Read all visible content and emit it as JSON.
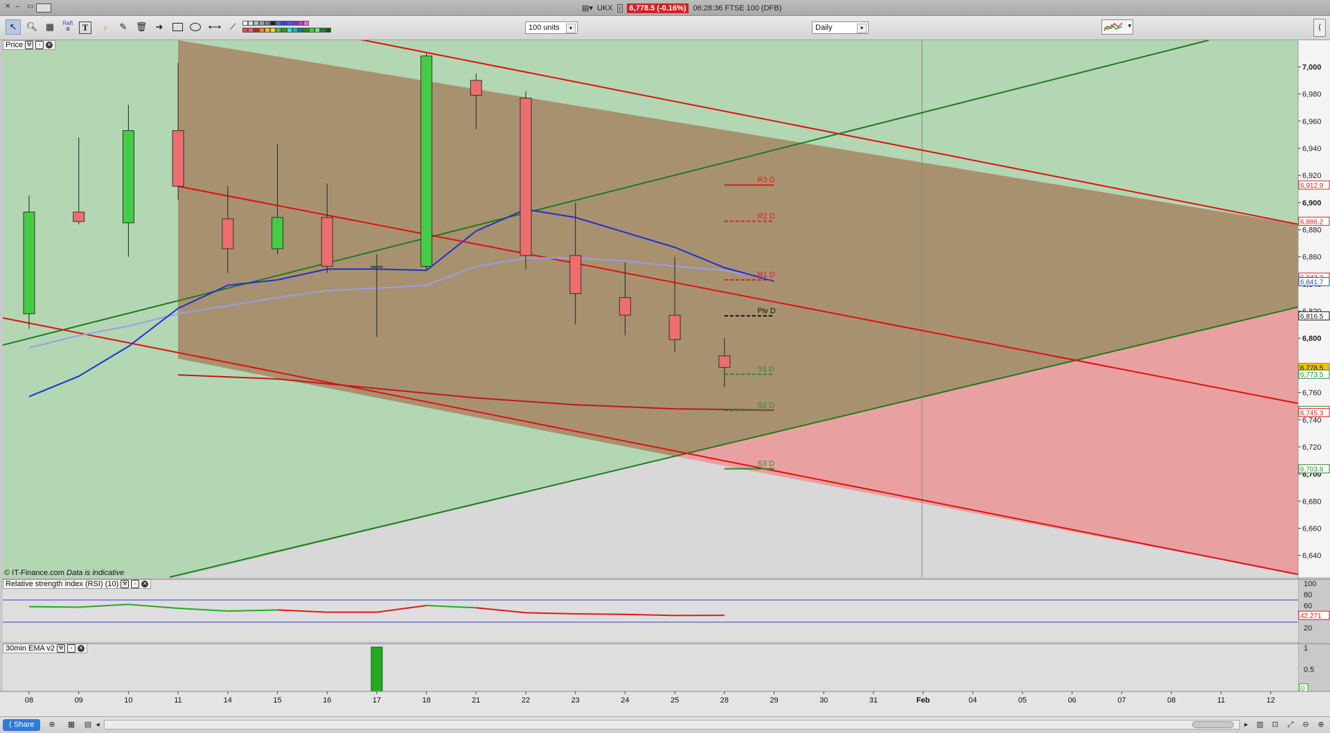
{
  "title_bar": {
    "instrument": "UKX",
    "price_chip": "6,778.5 (-0.16%)",
    "time_text": "06:28:36 FTSE 100 (DFB)"
  },
  "toolbar": {
    "units_select": "100 units",
    "period_select": "Daily",
    "raft_label": "Raft",
    "tools": [
      "pointer-icon",
      "zoom-icon",
      "chart-type-icon",
      "fibonacci-icon",
      "text-tool-icon",
      "alert-bell-icon",
      "draw-pen-icon",
      "trash-icon",
      "arrow-icon",
      "rectangle-icon",
      "ellipse-icon",
      "horizontal-line-icon",
      "trend-line-icon"
    ],
    "color_swatches_top": [
      "#ffffff",
      "#e0e0e0",
      "#c0c0c0",
      "#a0a0a0",
      "#808080",
      "#202020",
      "#3b6fd8",
      "#3c3ce0",
      "#5050ff",
      "#8a2be2",
      "#c040c0",
      "#ff60ff"
    ],
    "color_swatches_bottom": [
      "#ff4040",
      "#ff6060",
      "#c02020",
      "#ff8000",
      "#ffc000",
      "#ffe000",
      "#40c040",
      "#20a020",
      "#00ffff",
      "#00c0c0",
      "#008080",
      "#00a000",
      "#40d040",
      "#60ff60",
      "#208020",
      "#006000"
    ]
  },
  "panels": {
    "price_label": "Price",
    "rsi_label": "Relative strength index (RSI) (10)",
    "ema_label": "30min EMA v2"
  },
  "copyright": {
    "main": "© IT-Finance.com",
    "note": "Data is indicative"
  },
  "statusbar": {
    "share_label": "Share"
  },
  "chart_data": {
    "type": "candlestick",
    "x_labels": [
      "08",
      "09",
      "10",
      "11",
      "14",
      "15",
      "16",
      "17",
      "18",
      "21",
      "22",
      "23",
      "24",
      "25",
      "28",
      "29",
      "30",
      "31",
      "Feb",
      "04",
      "05",
      "06",
      "07",
      "08",
      "11",
      "12"
    ],
    "y_ticks": [
      "7,000",
      "6,980",
      "6,960",
      "6,940",
      "6,920",
      "6,900",
      "6,880",
      "6,860",
      "6,840",
      "6,820",
      "6,800",
      "6,780",
      "6,760",
      "6,740",
      "6,720",
      "6,700",
      "6,680",
      "6,660",
      "6,640"
    ],
    "ylim": [
      6624,
      7013
    ],
    "candles": [
      {
        "x": "08",
        "open": 6818,
        "close": 6893,
        "high": 6905,
        "low": 6807
      },
      {
        "x": "09",
        "open": 6893,
        "close": 6886,
        "high": 6948,
        "low": 6884
      },
      {
        "x": "10",
        "open": 6885,
        "close": 6953,
        "high": 6972,
        "low": 6860
      },
      {
        "x": "11",
        "open": 6953,
        "close": 6912,
        "high": 7003,
        "low": 6902
      },
      {
        "x": "14",
        "open": 6888,
        "close": 6866,
        "high": 6912,
        "low": 6848
      },
      {
        "x": "15",
        "open": 6866,
        "close": 6889,
        "high": 6943,
        "low": 6862
      },
      {
        "x": "16",
        "open": 6889,
        "close": 6853,
        "high": 6914,
        "low": 6848
      },
      {
        "x": "17",
        "open": 6853,
        "close": 6853,
        "high": 6862,
        "low": 6801
      },
      {
        "x": "18",
        "open": 6853,
        "close": 7008,
        "high": 7010,
        "low": 6851
      },
      {
        "x": "21",
        "open": 6990,
        "close": 6979,
        "high": 6995,
        "low": 6954
      },
      {
        "x": "22",
        "open": 6977,
        "close": 6861,
        "high": 6982,
        "low": 6851
      },
      {
        "x": "23",
        "open": 6861,
        "close": 6833,
        "high": 6900,
        "low": 6810
      },
      {
        "x": "24",
        "open": 6830,
        "close": 6817,
        "high": 6856,
        "low": 6802
      },
      {
        "x": "25",
        "open": 6817,
        "close": 6799,
        "high": 6860,
        "low": 6790
      },
      {
        "x": "28",
        "open": 6787,
        "close": 6778.5,
        "high": 6800,
        "low": 6764
      }
    ],
    "ema_blue": [
      [
        0,
        6757
      ],
      [
        1,
        6772
      ],
      [
        2,
        6794
      ],
      [
        3,
        6822
      ],
      [
        4,
        6839
      ],
      [
        5,
        6843
      ],
      [
        6,
        6851
      ],
      [
        7,
        6851
      ],
      [
        8,
        6850
      ],
      [
        9,
        6879
      ],
      [
        10,
        6895
      ],
      [
        11,
        6889
      ],
      [
        12,
        6878
      ],
      [
        13,
        6867
      ],
      [
        14,
        6852
      ],
      [
        15,
        6842
      ]
    ],
    "ema_lilac": [
      [
        0,
        6793
      ],
      [
        1,
        6802
      ],
      [
        2,
        6809
      ],
      [
        3,
        6818
      ],
      [
        4,
        6824
      ],
      [
        5,
        6830
      ],
      [
        6,
        6835
      ],
      [
        7,
        6837
      ],
      [
        8,
        6839
      ],
      [
        9,
        6853
      ],
      [
        10,
        6859
      ],
      [
        11,
        6859
      ],
      [
        12,
        6857
      ],
      [
        13,
        6853
      ],
      [
        14,
        6850
      ],
      [
        15,
        6843
      ]
    ],
    "ema_red": [
      [
        3,
        6773
      ],
      [
        5,
        6770
      ],
      [
        7,
        6763
      ],
      [
        9,
        6756
      ],
      [
        11,
        6751
      ],
      [
        13,
        6748
      ],
      [
        15,
        6747
      ]
    ],
    "pivots": [
      {
        "label": "R3 D",
        "value": 6912.9,
        "color": "#dd2020",
        "dash": false
      },
      {
        "label": "R2 D",
        "value": 6886.2,
        "color": "#dd2020",
        "dash": true
      },
      {
        "label": "R1 D",
        "value": 6843,
        "color": "#dd2020",
        "dash": true
      },
      {
        "label": "Piv D",
        "value": 6816.5,
        "color": "#111111",
        "dash": true
      },
      {
        "label": "S1 D",
        "value": 6773.5,
        "color": "#2a8a2a",
        "dash": true
      },
      {
        "label": "S2 D",
        "value": 6746.8,
        "color": "#2a8a2a",
        "dash": true
      },
      {
        "label": "S3 D",
        "value": 6703.8,
        "color": "#2a8a2a",
        "dash": false
      }
    ],
    "right_badges": [
      {
        "text": "6,912.9",
        "value": 6912.9,
        "bg": "#ffffff",
        "fg": "#dd2020",
        "border": "#dd2020"
      },
      {
        "text": "6,886.2",
        "value": 6886.2,
        "bg": "#ffffff",
        "fg": "#dd2020",
        "border": "#dd2020"
      },
      {
        "text": "6,843.2",
        "value": 6845,
        "bg": "#ffffff",
        "fg": "#dd2020",
        "border": "#dd2020"
      },
      {
        "text": "6,841.7",
        "value": 6841.7,
        "bg": "#ffffff",
        "fg": "#2244cc",
        "border": "#2244cc"
      },
      {
        "text": "6,816.5",
        "value": 6816.5,
        "bg": "#ffffff",
        "fg": "#111111",
        "border": "#111111"
      },
      {
        "text": "6,778.5",
        "value": 6778.5,
        "bg": "#f2c200",
        "fg": "#111111",
        "border": "#aa8800"
      },
      {
        "text": "6,773.5",
        "value": 6773.5,
        "bg": "#ffffff",
        "fg": "#2a8a2a",
        "border": "#2a8a2a"
      },
      {
        "text": "6,746.8",
        "value": 6746.8,
        "bg": "#ffffff",
        "fg": "#2a8a2a",
        "border": "#2a8a2a"
      },
      {
        "text": "6,745.3",
        "value": 6745.3,
        "bg": "#ffffff",
        "fg": "#dd2020",
        "border": "#dd2020"
      },
      {
        "text": "6,703.8",
        "value": 6703.8,
        "bg": "#ffffff",
        "fg": "#2a8a2a",
        "border": "#2a8a2a"
      }
    ],
    "rsi": {
      "ticks": [
        "100",
        "80",
        "60",
        "40",
        "20"
      ],
      "ylim": [
        0,
        100
      ],
      "values": [
        [
          0,
          58
        ],
        [
          1,
          57
        ],
        [
          2,
          62
        ],
        [
          3,
          55
        ],
        [
          4,
          50
        ],
        [
          5,
          52
        ],
        [
          6,
          48
        ],
        [
          7,
          48
        ],
        [
          8,
          60
        ],
        [
          9,
          56
        ],
        [
          10,
          47
        ],
        [
          11,
          45
        ],
        [
          12,
          44
        ],
        [
          13,
          42
        ],
        [
          14,
          42.271
        ]
      ],
      "last_label": "42.271",
      "bands": [
        70,
        30
      ]
    },
    "ema30": {
      "ticks": [
        "1",
        "0.5",
        "0"
      ],
      "bars": [
        {
          "index": 7,
          "value": 1
        }
      ],
      "last_label": "0"
    }
  },
  "colors": {
    "green_zone": "#b3d6b3",
    "brown_channel": "#a88d6b",
    "red_zone": "#e8a0a0",
    "grey_zone": "#d8d8d8",
    "bull": "#44cc44",
    "bear": "#ee6e6e",
    "accent_blue": "#2f7bd6"
  }
}
